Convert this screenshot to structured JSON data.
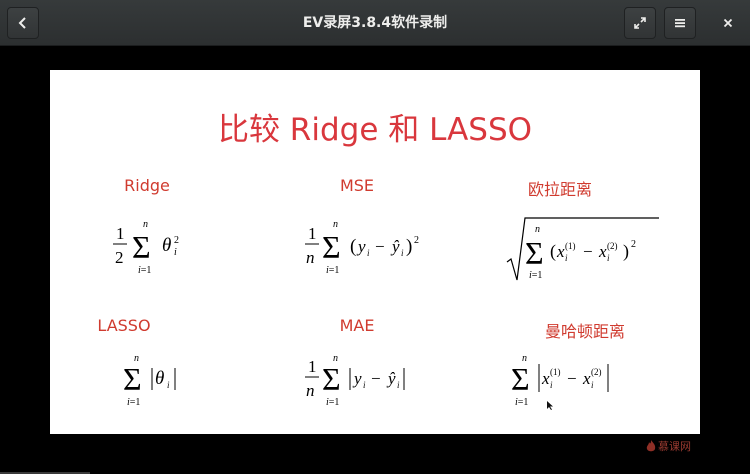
{
  "window": {
    "title": "EV录屏3.8.4软件录制"
  },
  "slide": {
    "title": "比较 Ridge 和 LASSO",
    "items": [
      {
        "label": "Ridge"
      },
      {
        "label": "MSE"
      },
      {
        "label": "欧拉距离"
      },
      {
        "label": "LASSO"
      },
      {
        "label": "MAE"
      },
      {
        "label": "曼哈顿距离"
      }
    ]
  },
  "watermark": {
    "text": "慕课网"
  },
  "colors": {
    "accent_red": "#d9373d",
    "titlebar": "#2f3233"
  },
  "icons": [
    "back-icon",
    "fullscreen-icon",
    "menu-icon",
    "close-icon"
  ]
}
